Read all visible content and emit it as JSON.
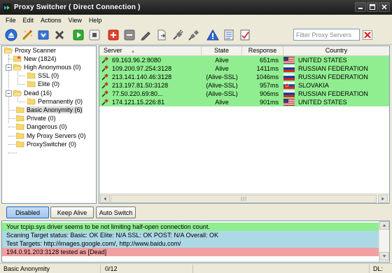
{
  "window": {
    "title": "Proxy Switcher  ( Direct Connection )"
  },
  "menu": {
    "items": [
      "File",
      "Edit",
      "Actions",
      "View",
      "Help"
    ]
  },
  "toolbar": {
    "filter_placeholder": "Filter Proxy Servers",
    "icons": [
      "connect-icon",
      "wand-icon",
      "download-icon",
      "close-x-icon",
      "play-icon",
      "stop-icon",
      "add-icon",
      "remove-icon",
      "edit-pencil-icon",
      "export-icon",
      "plug-icon",
      "plug-disconnect-icon",
      "warning-icon",
      "list-icon",
      "checklist-icon"
    ]
  },
  "tree": {
    "nodes": [
      {
        "label": "Proxy Scanner"
      },
      {
        "label": "New (1824)"
      },
      {
        "label": "High Anonymous (0)"
      },
      {
        "label": "SSL (0)"
      },
      {
        "label": "Elite (0)"
      },
      {
        "label": "Dead (16)"
      },
      {
        "label": "Permanently (0)"
      },
      {
        "label": "Basic Anonymity (6)"
      },
      {
        "label": "Private (0)"
      },
      {
        "label": "Dangerous (0)"
      },
      {
        "label": "My Proxy Servers (0)"
      },
      {
        "label": "ProxySwitcher (0)"
      }
    ]
  },
  "list": {
    "headers": {
      "server": "Server",
      "sort_indicator": "▲",
      "state": "State",
      "response": "Response",
      "country": "Country"
    },
    "rows": [
      {
        "server": "69.163.96.2:8080",
        "state": "Alive",
        "response": "651ms",
        "country": "UNITED STATES",
        "flag": "us"
      },
      {
        "server": "109.200.97.254:3128",
        "state": "Alive",
        "response": "1411ms",
        "country": "RUSSIAN FEDERATION",
        "flag": "ru"
      },
      {
        "server": "213.141.140.46:3128",
        "state": "(Alive-SSL)",
        "response": "1046ms",
        "country": "RUSSIAN FEDERATION",
        "flag": "ru"
      },
      {
        "server": "213.197.81.50:3128",
        "state": "(Alive-SSL)",
        "response": "957ms",
        "country": "SLOVAKIA",
        "flag": "sk"
      },
      {
        "server": "77.50.220.69:80...",
        "state": "(Alive-SSL)",
        "response": "906ms",
        "country": "RUSSIAN FEDERATION",
        "flag": "ru"
      },
      {
        "server": "174.121.15.226:81",
        "state": "Alive",
        "response": "901ms",
        "country": "UNITED STATES",
        "flag": "us"
      }
    ],
    "row_color": "#90ee90"
  },
  "buttons": {
    "disabled": "Disabled",
    "keep_alive": "Keep Alive",
    "auto_switch": "Auto Switch"
  },
  "log": {
    "lines": [
      {
        "text": "Your tcpip.sys driver seems to be not limiting half-open connection count.",
        "color": "#90ee90"
      },
      {
        "text": "Scaning Target status:   Basic:  OK  Elite: N/A  SSL:  OK POST: N/A  Overall:  OK",
        "color": "#add8e6"
      },
      {
        "text": "Test Targets: http://images.google.com/, http://www.baidu.com/",
        "color": "#add8e6"
      },
      {
        "text": "194.0.91.203:3128 tested as [Dead]",
        "color": "#f0a0a0"
      }
    ]
  },
  "status": {
    "category": "Basic Anonymity",
    "count": "0/12",
    "dl": "DL:"
  }
}
